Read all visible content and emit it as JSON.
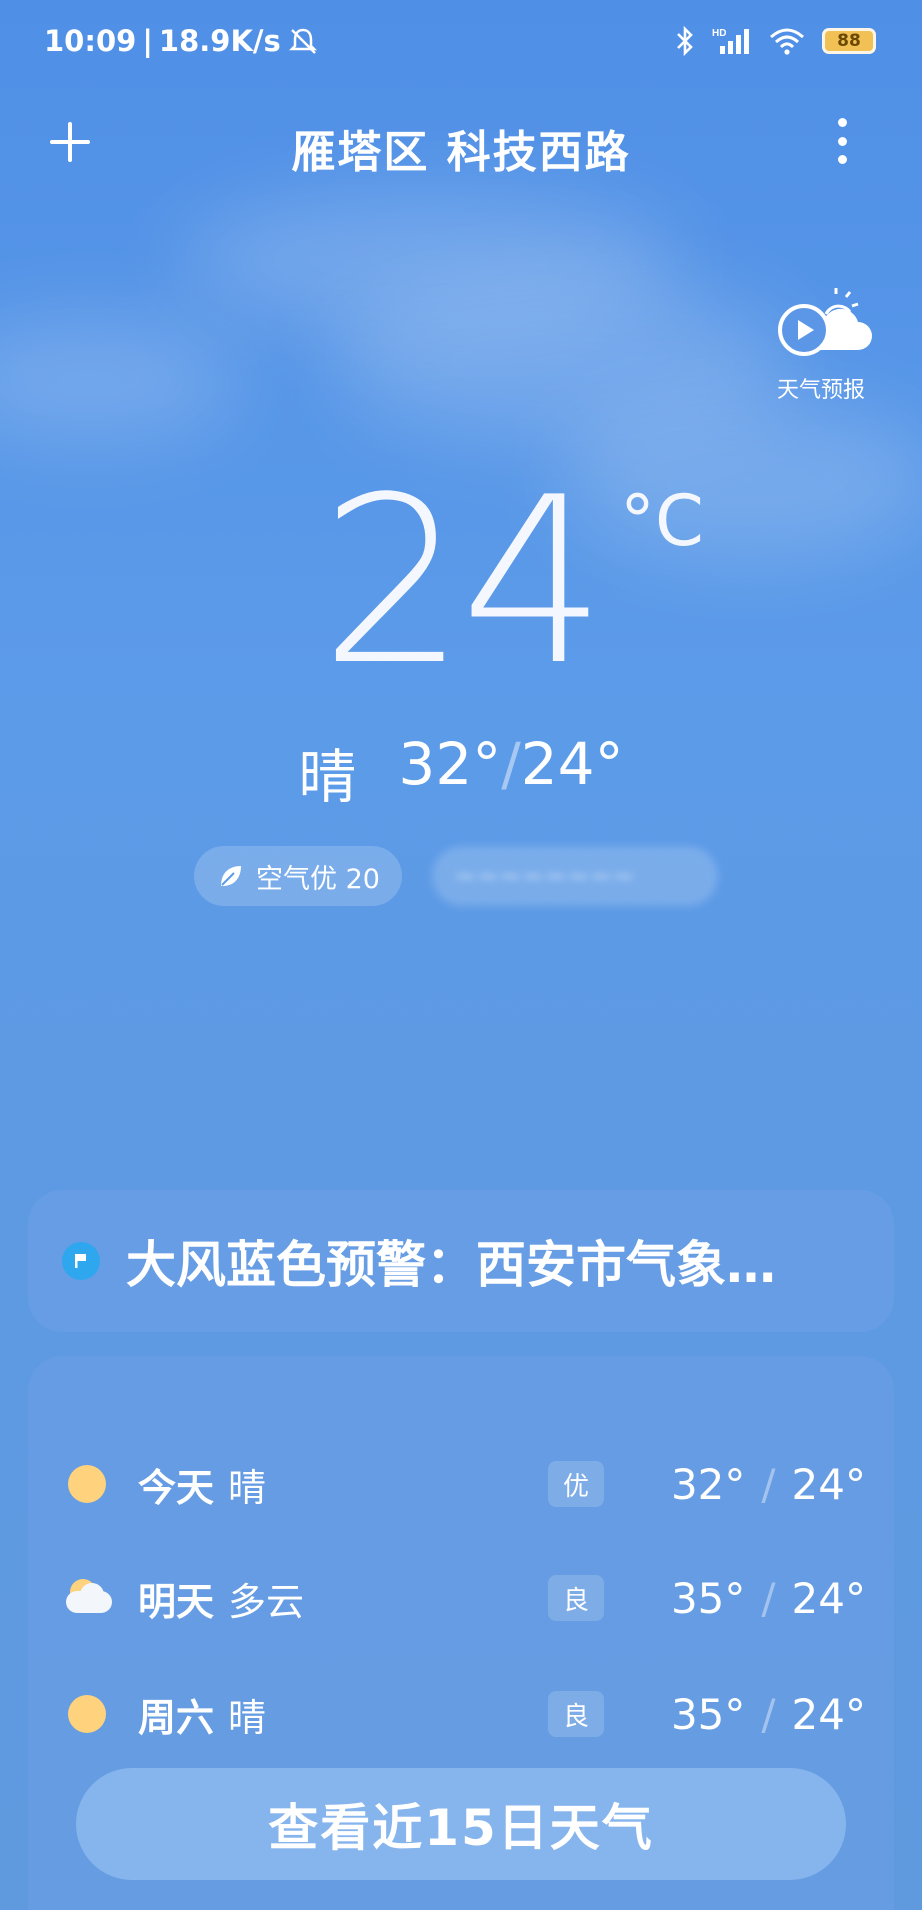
{
  "status_bar": {
    "time": "10:09",
    "network_speed": "18.9K/s",
    "battery": "88"
  },
  "header": {
    "location": "雁塔区 科技西路"
  },
  "forecast_video": {
    "label": "天气预报"
  },
  "current": {
    "temperature": "24",
    "unit": "°C",
    "condition": "晴",
    "high": "32°",
    "low": "24°",
    "slash": "/"
  },
  "pills": {
    "air_quality": "空气优 20",
    "blurred": "~~~~~~~~"
  },
  "alert": {
    "text": "大风蓝色预警：西安市气象…"
  },
  "daily": [
    {
      "day": "今天",
      "condition": "晴",
      "aqi": "优",
      "high": "32°",
      "low": "24°",
      "icon": "sun-icon"
    },
    {
      "day": "明天",
      "condition": "多云",
      "aqi": "良",
      "high": "35°",
      "low": "24°",
      "icon": "partly-cloudy-icon"
    },
    {
      "day": "周六",
      "condition": "晴",
      "aqi": "良",
      "high": "35°",
      "low": "24°",
      "icon": "sun-icon"
    }
  ],
  "cta": {
    "label": "查看近15日天气"
  },
  "colors": {
    "sky_top": "#4f8fe6",
    "sun": "#ffd27e",
    "alert_icon": "#2ea7ee",
    "battery": "#f1c156"
  }
}
